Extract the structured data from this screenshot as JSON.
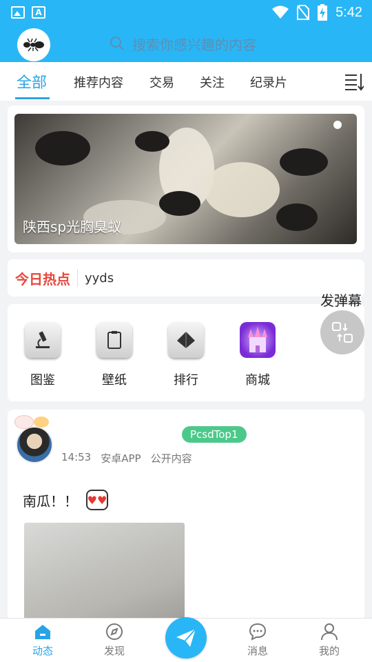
{
  "status_bar": {
    "time": "5:42",
    "left_icons": [
      "image-notification-icon",
      "document-notification-icon"
    ],
    "right_icons": [
      "wifi-icon",
      "no-sim-icon",
      "battery-charging-icon"
    ]
  },
  "header": {
    "logo_icon": "ant-logo-icon",
    "search_placeholder": "搜索你感兴趣的内容"
  },
  "tabs": [
    {
      "label": "全部",
      "active": true
    },
    {
      "label": "推荐内容",
      "active": false
    },
    {
      "label": "交易",
      "active": false
    },
    {
      "label": "关注",
      "active": false
    },
    {
      "label": "纪录片",
      "active": false
    }
  ],
  "banner": {
    "caption": "陕西sp光胸臭蚁"
  },
  "hot": {
    "title": "今日热点",
    "text": "yyds"
  },
  "danmaku": {
    "label": "发弹幕"
  },
  "features": [
    {
      "label": "图鉴",
      "icon": "microscope-icon"
    },
    {
      "label": "壁纸",
      "icon": "clipboard-icon"
    },
    {
      "label": "排行",
      "icon": "pyramid-icon"
    },
    {
      "label": "商城",
      "icon": "castle-icon"
    }
  ],
  "post": {
    "badge": "PcsdTop1",
    "time": "14:53",
    "source": "安卓APP",
    "visibility": "公开内容",
    "text": "南瓜！！",
    "emoji": "heart-eyes-emoji-icon"
  },
  "bottom_nav": [
    {
      "label": "动态",
      "icon": "home-icon",
      "active": true
    },
    {
      "label": "发现",
      "icon": "compass-icon",
      "active": false
    },
    {
      "label": "消息",
      "icon": "chat-icon",
      "active": false
    },
    {
      "label": "我的",
      "icon": "person-icon",
      "active": false
    }
  ],
  "colors": {
    "primary": "#29b6f6",
    "accent": "#29a3e6",
    "hot": "#e8473d",
    "badge": "#4cc98a"
  }
}
